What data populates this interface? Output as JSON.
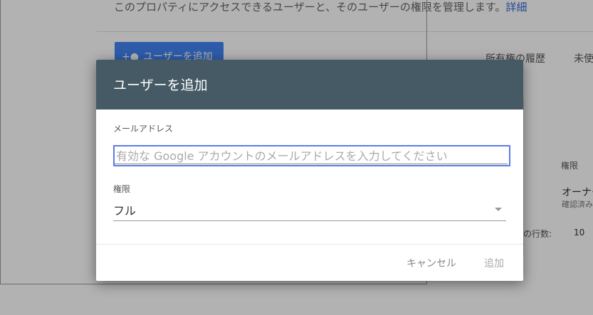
{
  "background": {
    "description": "このプロパティにアクセスできるユーザーと、そのユーザーの権限を管理します。",
    "details_link": "詳細",
    "add_user_button": "ユーザーを追加",
    "ownership_history": "所有権の履歴",
    "unconfirmed": "未使",
    "table_header_permission": "権限",
    "row_permission": "オーナー",
    "row_status": "確認済み",
    "rows_label": "の行数:",
    "rows_value": "10"
  },
  "dialog": {
    "title": "ユーザーを追加",
    "email_label": "メールアドレス",
    "email_placeholder": "有効な Google アカウントのメールアドレスを入力してください",
    "email_value": "",
    "permission_label": "権限",
    "permission_value": "フル",
    "cancel_label": "キャンセル",
    "add_label": "追加"
  },
  "colors": {
    "dialog_header": "#455a64",
    "input_focus": "#5b7ce8",
    "primary_button": "#4285f4",
    "link": "#3367d6"
  }
}
